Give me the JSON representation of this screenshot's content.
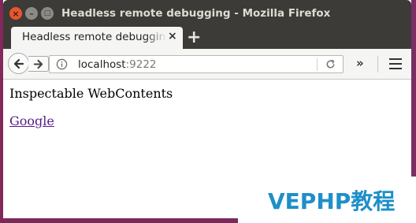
{
  "window": {
    "title": "Headless remote debugging - Mozilla Firefox",
    "close_glyph": "×",
    "minimize_glyph": "–",
    "maximize_glyph": "□"
  },
  "tabs": [
    {
      "label": "Headless remote debugging",
      "active": true,
      "close_glyph": "×"
    }
  ],
  "new_tab_glyph": "+",
  "nav": {
    "url_host": "localhost",
    "url_port": ":9222",
    "overflow_glyph": "»"
  },
  "page": {
    "heading": "Inspectable WebContents",
    "link_text": "Google"
  },
  "watermark": {
    "text": "VEPHP教程"
  },
  "colors": {
    "titlebar": "#3c3b37",
    "close_button": "#e9552d",
    "visited_link": "#551a8b",
    "watermark": "#1e8fc8",
    "desktop": "#7a2a5a"
  },
  "icons": [
    "close-icon",
    "minimize-icon",
    "maximize-icon",
    "back-arrow-icon",
    "forward-arrow-icon",
    "info-icon",
    "reload-icon",
    "overflow-chevron-icon",
    "hamburger-menu-icon"
  ]
}
